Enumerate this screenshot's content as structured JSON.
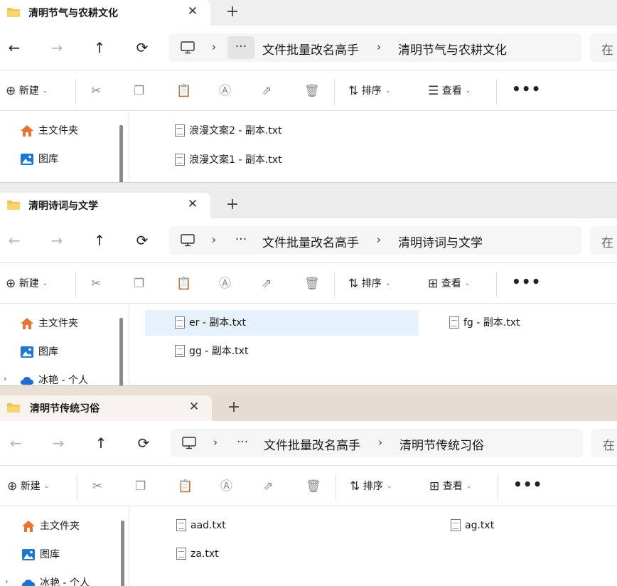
{
  "windows": [
    {
      "tab_title": "清明节气与农耕文化",
      "path": [
        "文件批量改名高手",
        "清明节气与农耕文化"
      ],
      "search_placeholder": "在",
      "toolbar": {
        "new": "新建",
        "sort": "排序",
        "view": "查看"
      },
      "sidebar": {
        "home": "主文件夹",
        "gallery": "图库"
      },
      "files": [
        "浪漫文案2 - 副本.txt",
        "浪漫文案1 - 副本.txt"
      ]
    },
    {
      "tab_title": "清明诗词与文学",
      "path": [
        "文件批量改名高手",
        "清明诗词与文学"
      ],
      "search_placeholder": "在",
      "toolbar": {
        "new": "新建",
        "sort": "排序",
        "view": "查看"
      },
      "sidebar": {
        "home": "主文件夹",
        "gallery": "图库",
        "cloud": "冰艳 - 个人"
      },
      "files": [
        "er - 副本.txt",
        "fg - 副本.txt",
        "gg - 副本.txt"
      ]
    },
    {
      "tab_title": "清明节传统习俗",
      "path": [
        "文件批量改名高手",
        "清明节传统习俗"
      ],
      "search_placeholder": "在",
      "toolbar": {
        "new": "新建",
        "sort": "排序",
        "view": "查看"
      },
      "sidebar": {
        "home": "主文件夹",
        "gallery": "图库",
        "cloud": "冰艳 - 个人"
      },
      "files": [
        "aad.txt",
        "ag.txt",
        "za.txt"
      ]
    }
  ],
  "icons": {
    "folder_color": "#f2c14e",
    "home_color": "#e8742c",
    "gallery_color": "#1e78d2",
    "cloud_color": "#1f6fd1",
    "selection_color": "#e5f1fb"
  }
}
